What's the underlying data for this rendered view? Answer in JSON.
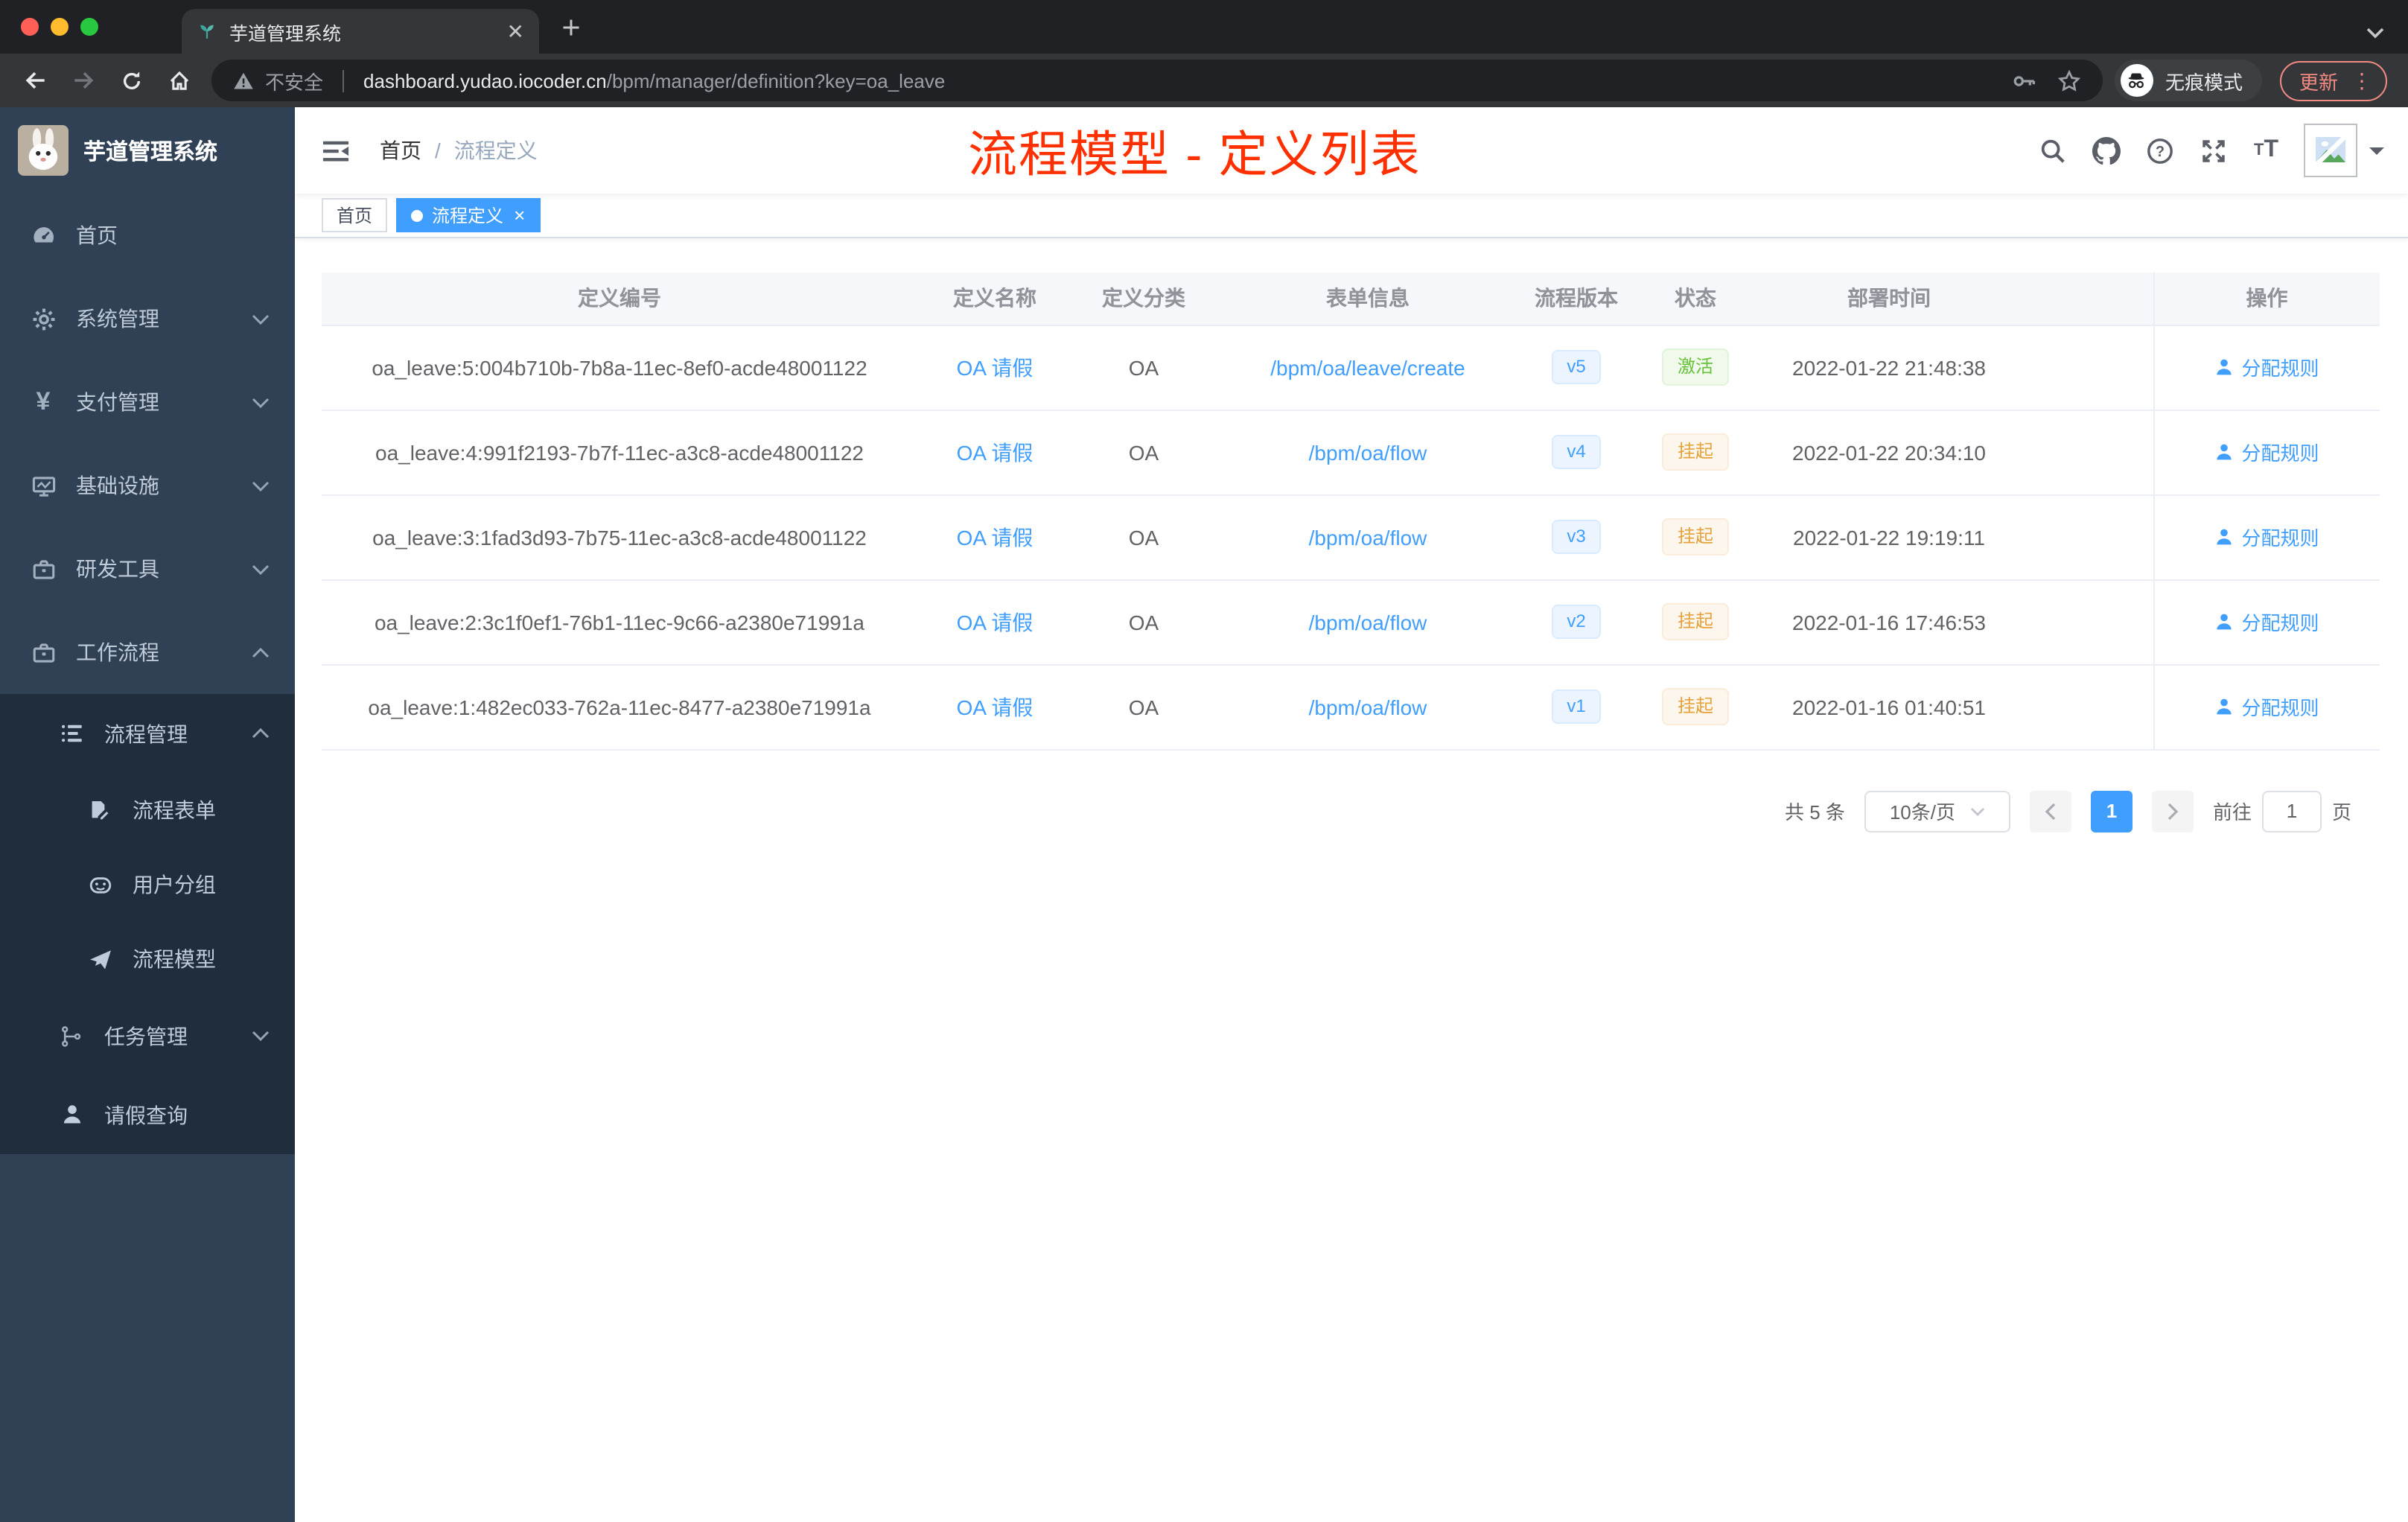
{
  "browser": {
    "tab_title": "芋道管理系统",
    "security_label": "不安全",
    "url_host": "dashboard.yudao.iocoder.cn",
    "url_path": "/bpm/manager/definition?key=oa_leave",
    "incognito_label": "无痕模式",
    "update_label": "更新",
    "traffic_colors": {
      "close": "#ff5f57",
      "minimize": "#febc2e",
      "zoom": "#28c840"
    }
  },
  "sidebar": {
    "logo_title": "芋道管理系统",
    "items": [
      {
        "label": "首页"
      },
      {
        "label": "系统管理"
      },
      {
        "label": "支付管理"
      },
      {
        "label": "基础设施"
      },
      {
        "label": "研发工具"
      },
      {
        "label": "工作流程"
      }
    ],
    "sub_items": [
      {
        "label": "流程管理"
      },
      {
        "label": "流程表单"
      },
      {
        "label": "用户分组"
      },
      {
        "label": "流程模型"
      },
      {
        "label": "任务管理"
      },
      {
        "label": "请假查询"
      }
    ]
  },
  "header": {
    "breadcrumb": {
      "home": "首页",
      "separator": "/",
      "current": "流程定义"
    },
    "annotation": "流程模型 - 定义列表",
    "annotation_color": "#ff3000"
  },
  "tags": [
    {
      "label": "首页"
    },
    {
      "label": "流程定义"
    }
  ],
  "table": {
    "headers": [
      "定义编号",
      "定义名称",
      "定义分类",
      "表单信息",
      "流程版本",
      "状态",
      "部署时间",
      "操作"
    ],
    "action_label": "分配规则",
    "rows": [
      {
        "id": "oa_leave:5:004b710b-7b8a-11ec-8ef0-acde48001122",
        "name": "OA 请假",
        "category": "OA",
        "form": "/bpm/oa/leave/create",
        "version": "v5",
        "status": "激活",
        "time": "2022-01-22 21:48:38"
      },
      {
        "id": "oa_leave:4:991f2193-7b7f-11ec-a3c8-acde48001122",
        "name": "OA 请假",
        "category": "OA",
        "form": "/bpm/oa/flow",
        "version": "v4",
        "status": "挂起",
        "time": "2022-01-22 20:34:10"
      },
      {
        "id": "oa_leave:3:1fad3d93-7b75-11ec-a3c8-acde48001122",
        "name": "OA 请假",
        "category": "OA",
        "form": "/bpm/oa/flow",
        "version": "v3",
        "status": "挂起",
        "time": "2022-01-22 19:19:11"
      },
      {
        "id": "oa_leave:2:3c1f0ef1-76b1-11ec-9c66-a2380e71991a",
        "name": "OA 请假",
        "category": "OA",
        "form": "/bpm/oa/flow",
        "version": "v2",
        "status": "挂起",
        "time": "2022-01-16 17:46:53"
      },
      {
        "id": "oa_leave:1:482ec033-762a-11ec-8477-a2380e71991a",
        "name": "OA 请假",
        "category": "OA",
        "form": "/bpm/oa/flow",
        "version": "v1",
        "status": "挂起",
        "time": "2022-01-16 01:40:51"
      }
    ]
  },
  "pagination": {
    "total": "共 5 条",
    "page_size": "10条/页",
    "current_page": "1",
    "goto_label": "前往",
    "goto_value": "1",
    "page_unit": "页"
  },
  "colors": {
    "accent_blue": "#409eff",
    "sidebar_bg": "#304156",
    "submenu_bg": "#1f2d3d",
    "success_green": "#67c23a",
    "warning_orange": "#e6a23c"
  }
}
